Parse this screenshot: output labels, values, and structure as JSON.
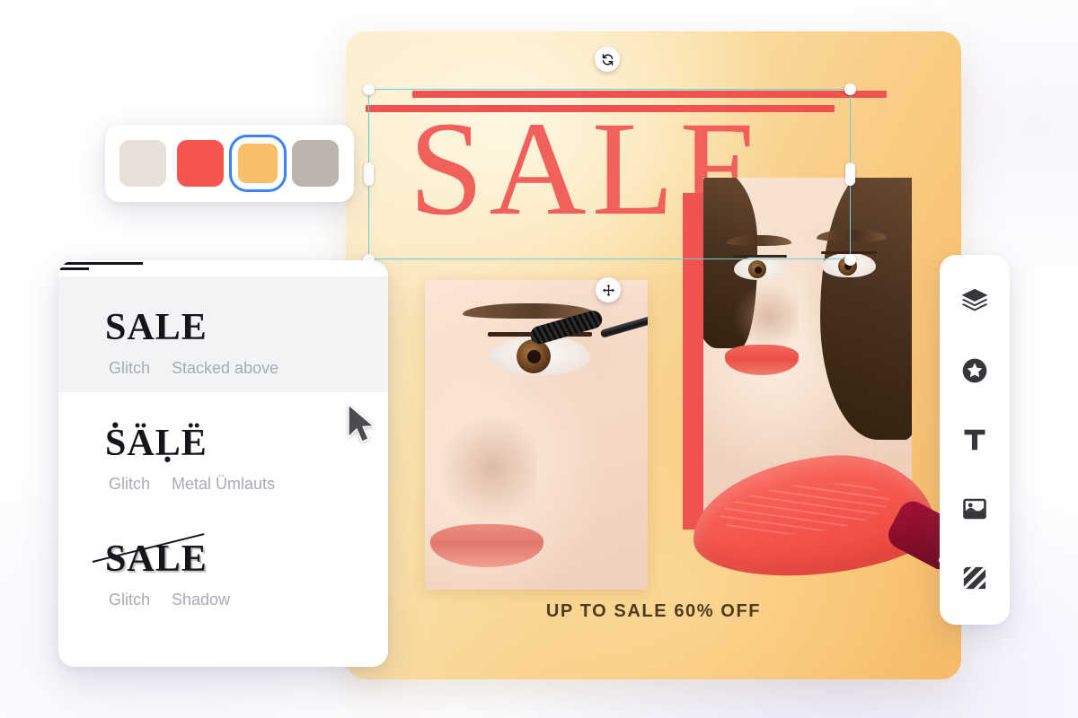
{
  "app": {
    "background_color": "#fefeff"
  },
  "color_panel": {
    "name": "color-swatch-palette",
    "swatches": [
      {
        "name": "swatch-cream",
        "color": "#e6e0d8",
        "selected": false
      },
      {
        "name": "swatch-red",
        "color": "#f6544f",
        "selected": false
      },
      {
        "name": "swatch-orange",
        "color": "#f9bf68",
        "selected": true
      },
      {
        "name": "swatch-taupe",
        "color": "#bcb5ad",
        "selected": false
      }
    ],
    "selection_outline_color": "#3b82f6"
  },
  "effects_panel": {
    "name": "text-effects-list",
    "items": [
      {
        "preview_text": "SALE",
        "effect_group": "Glitch",
        "effect_variant": "Stacked above",
        "active": true,
        "style": "stacked-bars"
      },
      {
        "preview_text": "ṠÄḶË",
        "effect_group": "Glitch",
        "effect_variant": "Metal Ümlauts",
        "active": false,
        "style": "umlauts"
      },
      {
        "preview_text": "SALE",
        "effect_group": "Glitch",
        "effect_variant": "Shadow",
        "active": false,
        "style": "shadow-strike"
      }
    ]
  },
  "artboard": {
    "name": "design-canvas",
    "headline": "SALE",
    "headline_color": "#f2605c",
    "caption": "UP TO SALE 60% OFF",
    "caption_color": "#4d3b21",
    "background_gradient_from": "#fbecc8",
    "background_gradient_to": "#f6bb68",
    "accent_block_color": "#f0534f",
    "bars_color": "#f0534f"
  },
  "selection": {
    "name": "text-selection-frame",
    "border_color": "#63cfe0",
    "rotate_icon": "rotate-icon",
    "move_icon": "move-icon",
    "handles": [
      "top-left",
      "top-right",
      "bottom-left",
      "bottom-right",
      "middle-left",
      "middle-right"
    ]
  },
  "right_toolbar": {
    "name": "editor-tools",
    "tools": [
      {
        "name": "layers-icon",
        "label": "Layers"
      },
      {
        "name": "sticker-icon",
        "label": "Stickers"
      },
      {
        "name": "text-icon",
        "label": "Text"
      },
      {
        "name": "image-icon",
        "label": "Image"
      },
      {
        "name": "pattern-icon",
        "label": "Pattern"
      }
    ]
  },
  "cursor": {
    "name": "mouse-pointer",
    "color": "#4a4c52"
  }
}
